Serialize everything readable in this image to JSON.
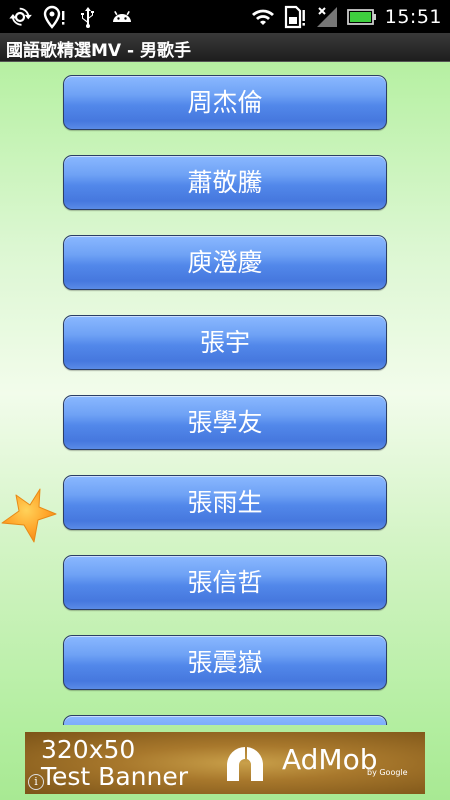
{
  "status_bar": {
    "time": "15:51",
    "left_icons": [
      "sync-icon",
      "location-alert-icon",
      "usb-icon",
      "android-icon"
    ],
    "right_icons": [
      "wifi-icon",
      "sim-alert-icon",
      "signal-icon",
      "battery-icon"
    ]
  },
  "title_bar": {
    "title": "國語歌精選MV - 男歌手"
  },
  "singers": [
    "周杰倫",
    "蕭敬騰",
    "庾澄慶",
    "張宇",
    "張學友",
    "張雨生",
    "張信哲",
    "張震嶽",
    ""
  ],
  "colors": {
    "button_blue": "#5288ea",
    "button_border": "#2b3e66",
    "background_green": "#b6f0a2",
    "star_orange": "#ff9d1e"
  },
  "ad": {
    "size_text": "320x50",
    "test_text": "Test Banner",
    "brand": "AdMob",
    "by_google": "by Google",
    "info_glyph": "i"
  }
}
